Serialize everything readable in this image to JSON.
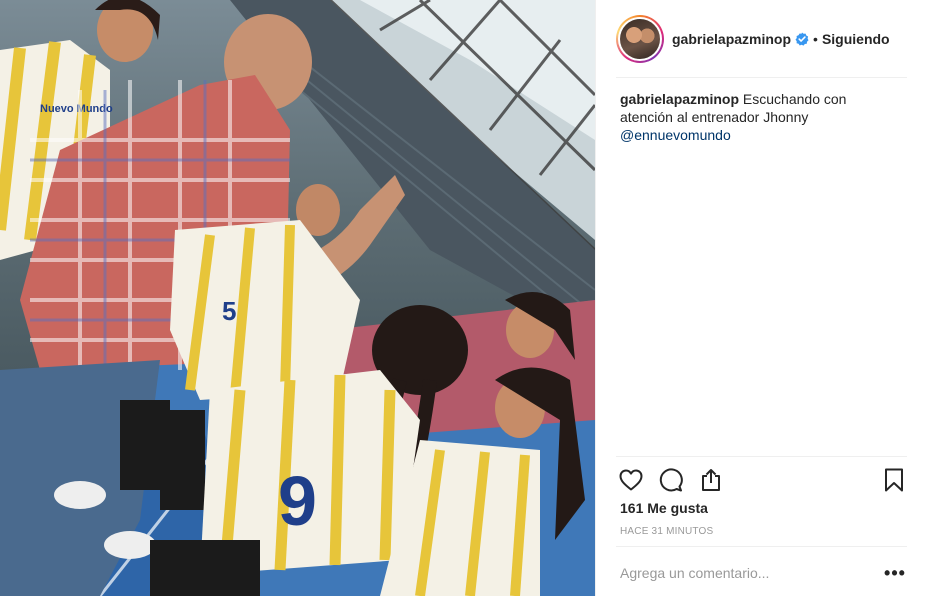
{
  "post": {
    "photo_alt": "Escuchando con atención al entrenador Jhonny",
    "jersey_numbers": [
      "5",
      "9"
    ],
    "jersey_text": "Nuevo Mundo"
  },
  "header": {
    "username": "gabrielapazminop",
    "separator": "•",
    "follow_label": "Siguiendo",
    "verified_icon": "verified-badge-icon",
    "verified_color": "#3897f0"
  },
  "caption": {
    "username": "gabrielapazminop",
    "text": "Escuchando con atención al entrenador Jhonny",
    "mention": "@ennuevomundo"
  },
  "actions": {
    "icons": [
      "heart-icon",
      "comment-icon",
      "share-icon",
      "bookmark-icon"
    ]
  },
  "likes_label": "161 Me gusta",
  "timestamp": "HACE 31 MINUTOS",
  "comment": {
    "placeholder": "Agrega un comentario...",
    "more_label": "•••"
  },
  "colors": {
    "text": "#262626",
    "muted": "#999999",
    "link": "#003569",
    "divider": "#efefef"
  }
}
